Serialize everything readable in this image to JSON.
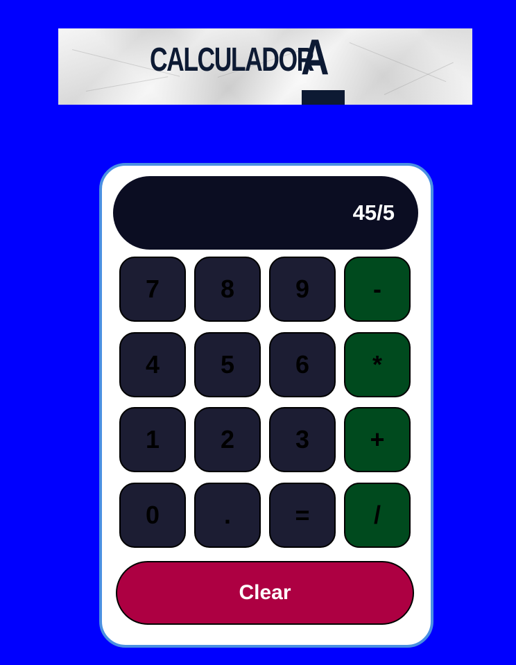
{
  "banner": {
    "logo_text": "CALCULADOR",
    "logo_letter": "A"
  },
  "display": {
    "value": "45/5"
  },
  "keys": {
    "k7": "7",
    "k8": "8",
    "k9": "9",
    "minus": "-",
    "k4": "4",
    "k5": "5",
    "k6": "6",
    "multiply": "*",
    "k1": "1",
    "k2": "2",
    "k3": "3",
    "plus": "+",
    "k0": "0",
    "dot": ".",
    "equals": "=",
    "divide": "/"
  },
  "clear_label": "Clear",
  "colors": {
    "page_background": "#0000ff",
    "calculator_border": "#4a90e2",
    "display_background": "#0b0d22",
    "number_key": "#1c1d33",
    "operator_key": "#004a1e",
    "clear_button": "#ad0042"
  }
}
